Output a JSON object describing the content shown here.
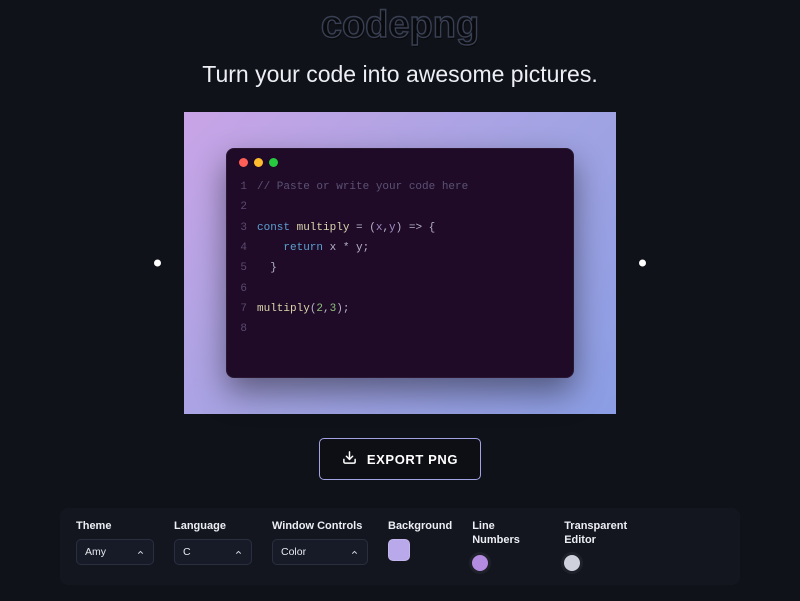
{
  "app": {
    "logo": "codepng",
    "tagline": "Turn your code into awesome pictures."
  },
  "editor": {
    "window_controls": {
      "close_color": "#ff5f56",
      "minimize_color": "#ffbd2e",
      "zoom_color": "#27c93f"
    },
    "lines": [
      {
        "n": 1,
        "tokens": [
          {
            "t": "// Paste or write your code here",
            "c": "tok-comment"
          }
        ]
      },
      {
        "n": 2,
        "tokens": []
      },
      {
        "n": 3,
        "tokens": [
          {
            "t": "const ",
            "c": "tok-keyword"
          },
          {
            "t": "multiply",
            "c": "tok-func"
          },
          {
            "t": " = (",
            "c": "tok-punc"
          },
          {
            "t": "x",
            "c": "tok-param"
          },
          {
            "t": ",",
            "c": "tok-punc"
          },
          {
            "t": "y",
            "c": "tok-param"
          },
          {
            "t": ") => {",
            "c": "tok-punc"
          }
        ]
      },
      {
        "n": 4,
        "tokens": [
          {
            "t": "    ",
            "c": "tok-plain"
          },
          {
            "t": "return ",
            "c": "tok-keyword"
          },
          {
            "t": "x",
            "c": "tok-plain"
          },
          {
            "t": " * ",
            "c": "tok-punc"
          },
          {
            "t": "y",
            "c": "tok-plain"
          },
          {
            "t": ";",
            "c": "tok-punc"
          }
        ]
      },
      {
        "n": 5,
        "tokens": [
          {
            "t": "  }",
            "c": "tok-punc"
          }
        ]
      },
      {
        "n": 6,
        "tokens": []
      },
      {
        "n": 7,
        "tokens": [
          {
            "t": "multiply",
            "c": "tok-func"
          },
          {
            "t": "(",
            "c": "tok-punc"
          },
          {
            "t": "2",
            "c": "tok-num"
          },
          {
            "t": ",",
            "c": "tok-punc"
          },
          {
            "t": "3",
            "c": "tok-num"
          },
          {
            "t": ");",
            "c": "tok-punc"
          }
        ]
      },
      {
        "n": 8,
        "tokens": []
      }
    ]
  },
  "actions": {
    "export_label": "EXPORT PNG"
  },
  "controls": {
    "theme": {
      "label": "Theme",
      "value": "Amy"
    },
    "language": {
      "label": "Language",
      "value": "C"
    },
    "window": {
      "label": "Window Controls",
      "value": "Color"
    },
    "background": {
      "label": "Background",
      "swatch": "#b9a8ea"
    },
    "line_numbers": {
      "label": "Line Numbers",
      "on": true,
      "on_color": "#b38be0"
    },
    "transparent_editor": {
      "label": "Transparent Editor",
      "on": false,
      "off_color": "#cfd2dc"
    }
  }
}
